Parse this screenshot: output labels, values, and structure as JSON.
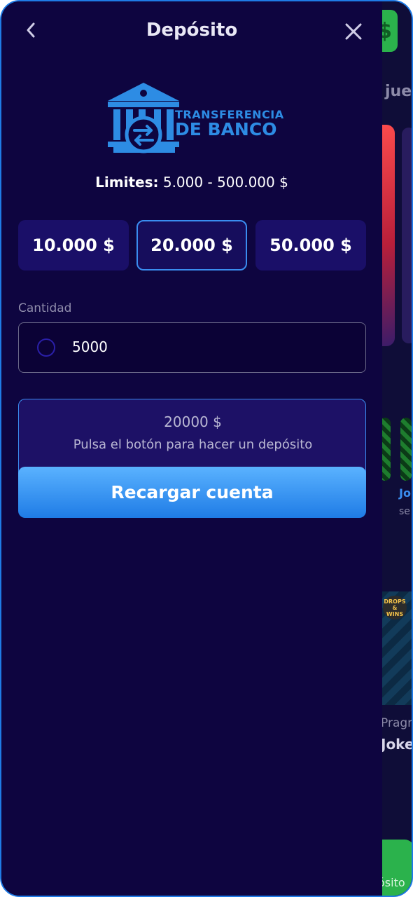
{
  "header": {
    "title": "Depósito",
    "back_icon": "chevron-left-icon",
    "close_icon": "close-icon"
  },
  "method": {
    "logo_line1": "TRANSFERENCIA",
    "logo_line2": "DE BANCO",
    "logo_icon": "bank-transfer-icon",
    "brand_color": "#2d8ce4"
  },
  "limits": {
    "label": "Limites:",
    "value": "5.000 - 500.000 $"
  },
  "quick_amounts": [
    "10.000 $",
    "20.000 $",
    "50.000 $"
  ],
  "selected_quick_amount": "20.000 $",
  "amount_field": {
    "label": "Cantidad",
    "value": "5000"
  },
  "summary": {
    "amount": "20000 $",
    "message": "Pulsa el botón para hacer un depósito"
  },
  "recharge_button": {
    "label": "Recargar cuenta"
  },
  "background_app": {
    "partial_text": [
      "jue",
      "Jo",
      "se",
      "Pragn",
      "Joke",
      "ósito"
    ],
    "badge": "DROPS & WINS",
    "currency_icon": "$"
  },
  "colors": {
    "panel_bg": "#0e0540",
    "accent_blue": "#3a8df0",
    "button_gradient_top": "#5ab2ff",
    "button_gradient_bottom": "#1f7ce6",
    "bg_green": "#2bb24c"
  }
}
